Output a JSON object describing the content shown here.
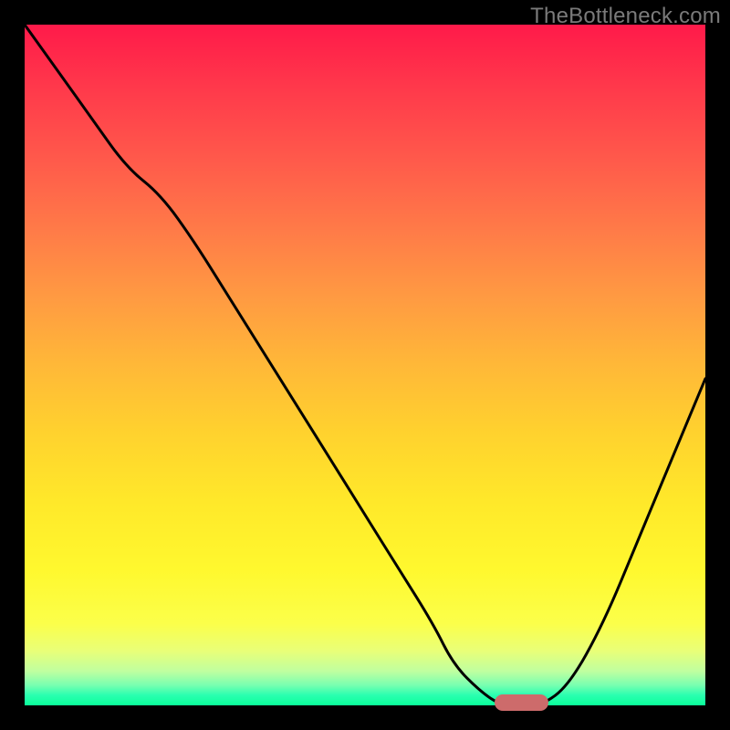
{
  "watermark": "TheBottleneck.com",
  "colors": {
    "background": "#000000",
    "gradient_top": "#ff1a4a",
    "gradient_bottom": "#0aff9a",
    "curve": "#000000",
    "marker": "#cd6b6b"
  },
  "chart_data": {
    "type": "line",
    "title": "",
    "xlabel": "",
    "ylabel": "",
    "xlim": [
      0,
      100
    ],
    "ylim": [
      0,
      100
    ],
    "x": [
      0,
      5,
      10,
      15,
      20,
      25,
      30,
      35,
      40,
      45,
      50,
      55,
      60,
      63,
      67,
      70,
      73,
      76,
      80,
      85,
      90,
      95,
      100
    ],
    "values": [
      100,
      93,
      86,
      79,
      75,
      68,
      60,
      52,
      44,
      36,
      28,
      20,
      12,
      6,
      2,
      0,
      0,
      0,
      3,
      12,
      24,
      36,
      48
    ],
    "annotations": [
      {
        "type": "marker",
        "x_start": 69,
        "x_end": 77,
        "y": 0
      }
    ]
  }
}
